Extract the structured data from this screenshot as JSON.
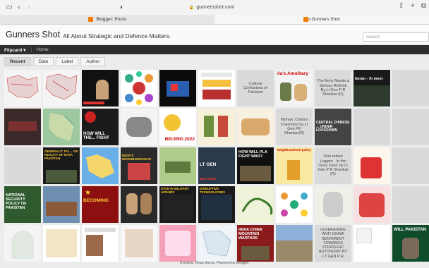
{
  "browser": {
    "url": "gunnersshot.com",
    "tabs": [
      {
        "label": "Blogger: Posts",
        "active": false
      },
      {
        "label": "Gunners Shot",
        "active": true
      }
    ]
  },
  "blog": {
    "title": "Gunners Shot",
    "subtitle": "All About Strategic and Defence Matters.",
    "search_placeholder": "search"
  },
  "nav": {
    "view_label": "Flipcard",
    "home_label": "Home"
  },
  "sort": {
    "buttons": [
      "Recent",
      "Date",
      "Label",
      "Author"
    ],
    "active": "Recent"
  },
  "posts": {
    "culture": "Cultural Confusions of Pakistan",
    "amulitary": "lia's Amulitary",
    "army_rethink": "The Army Needs a Serious Rethink By Lt Gen P R Shankar (R)",
    "imran": "Imran - Xi meet",
    "wuhan": "Wuhan: China's Chernobyl by Lt Gen PR Shankar(R)",
    "lockdown": "CENTRAL CHINESE ... UNDER LOCKDOWN",
    "how_fight": "HOW WILL THE... FIGHT",
    "beijing": "BEIJING 2022",
    "generals": "GENERALS' TAL... ON REALITY OF NAYA PAKISTAN",
    "neighbourhood": "INDIA'S NEIGHBOURHOOD",
    "lt_gen": "LT GEN",
    "brahmos": "BRAHMOS",
    "how_war": "HOW WILL PLA FIGHT WAR?",
    "neighbourhood_pol": "Neighbourhood policy",
    "logjam": "Sino Indian Logjam - In the 'Grey Zone' by Lt Gen P R Shankar (R)",
    "national_security": "NATIONAL SECURITY POLICY OF PAKISTAN",
    "becoming": "BECOMING",
    "military_affairs": "ITION IN MILITARY AFFAIRS",
    "disruptive": "DISRUPTIVE TECHNOLOGIES",
    "warfare": "INDIA CHINA MOUNTAIN WARFARE",
    "leveraging": "LEVERAGING ANTI CHINA SENTIMENT TOWARDS STRATEGIC AUTONOMY BY LT GEN P R",
    "will_pakistan": "WILL PAKISTAN"
  },
  "footer": "Dynamic Views theme. Powered by Blogger."
}
